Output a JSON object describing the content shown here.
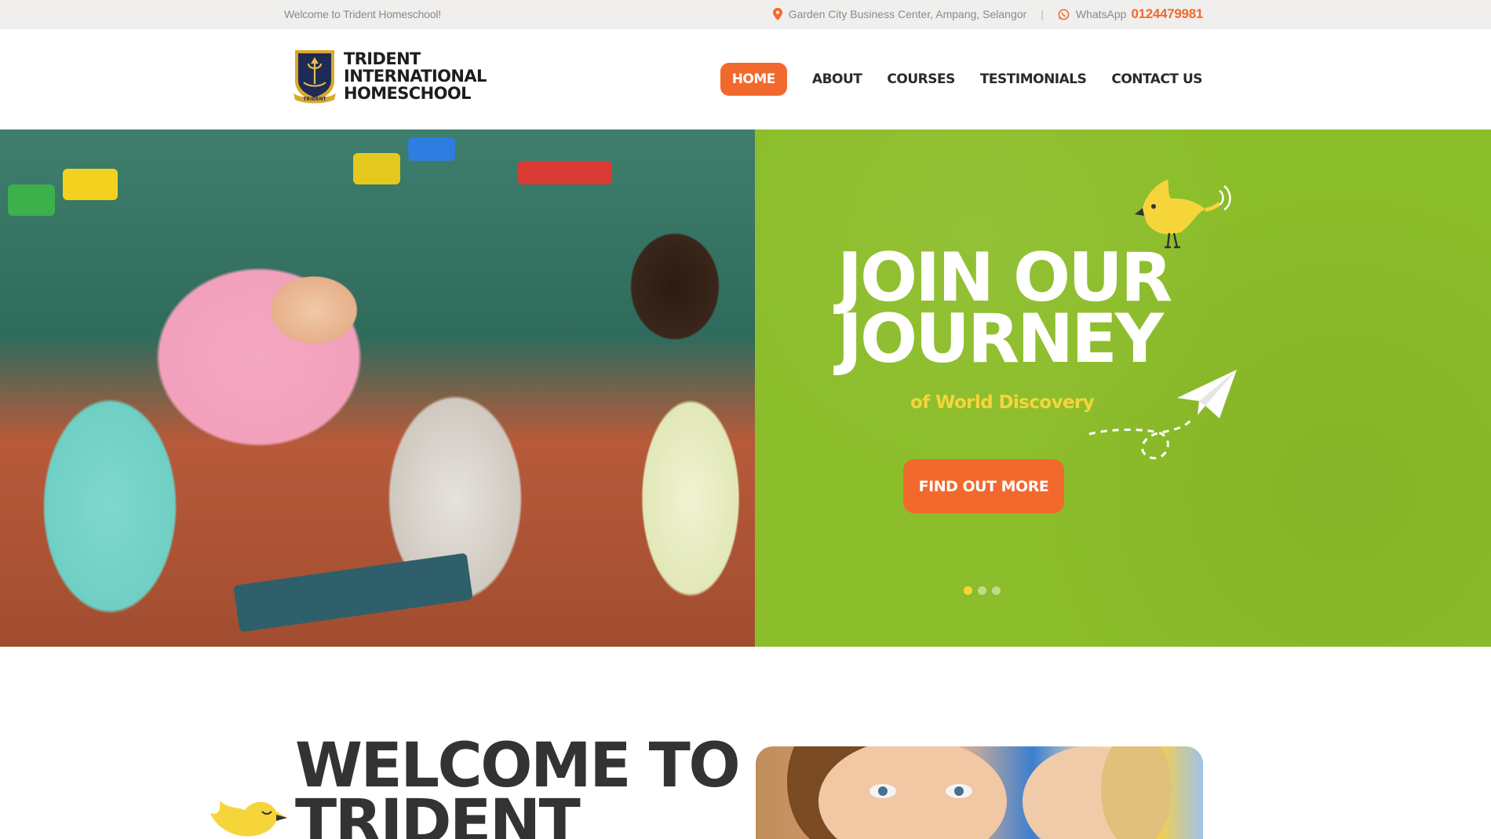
{
  "topbar": {
    "welcome": "Welcome to Trident Homeschool!",
    "address": "Garden City Business Center, Ampang, Selangor",
    "separator": "|",
    "whatsapp_label": "WhatsApp",
    "phone": "0124479981",
    "icons": [
      "map-pin-icon",
      "whatsapp-icon"
    ]
  },
  "header": {
    "logo_line1": "TRIDENT",
    "logo_line2": "INTERNATIONAL",
    "logo_line3": "HOMESCHOOL",
    "crest_text": "TRIDENT"
  },
  "nav": {
    "items": [
      {
        "label": "HOME",
        "active": true
      },
      {
        "label": "ABOUT",
        "active": false
      },
      {
        "label": "COURSES",
        "active": false
      },
      {
        "label": "TESTIMONIALS",
        "active": false
      },
      {
        "label": "CONTACT US",
        "active": false
      }
    ]
  },
  "hero": {
    "title_line1": "JOIN OUR",
    "title_line2": "JOURNEY",
    "subtitle": "of World Discovery",
    "button": "FIND OUT MORE",
    "slides": 3,
    "active_slide": 1
  },
  "welcome": {
    "title_line1": "WELCOME TO",
    "title_line2": "TRIDENT"
  },
  "colors": {
    "accent": "#f2692d",
    "hero_green": "#8cbd2a",
    "subtitle_yellow": "#f6d53b",
    "topbar_bg": "#f0efed"
  }
}
